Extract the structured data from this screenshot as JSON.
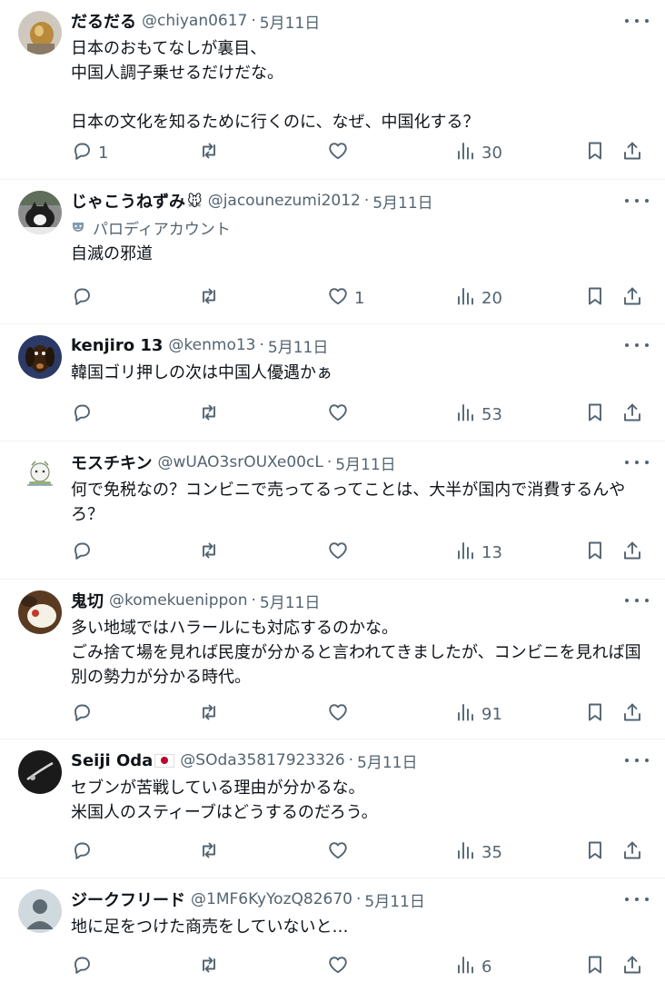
{
  "tweets": [
    {
      "name": "だるだる",
      "name_emoji": "",
      "has_flag": false,
      "handle": "@chiyan0617",
      "date": "5月11日",
      "parody_label": "",
      "text": "日本のおもてなしが裏目、\n中国人調子乗せるだけだな。\n\n日本の文化を知るために行くのに、なぜ、中国化する？",
      "replies": "1",
      "retweets": "",
      "likes": "",
      "views": "30",
      "avatar": "gold-lamp"
    },
    {
      "name": "じゃこうねずみ",
      "name_emoji": "🐭",
      "has_flag": false,
      "handle": "@jacounezumi2012",
      "date": "5月11日",
      "parody_label": "パロディアカウント",
      "text": "自滅の邪道",
      "replies": "",
      "retweets": "",
      "likes": "1",
      "views": "20",
      "avatar": "cat"
    },
    {
      "name": "kenjiro 13",
      "name_emoji": "",
      "has_flag": false,
      "handle": "@kenmo13",
      "date": "5月11日",
      "parody_label": "",
      "text": "韓国ゴリ押しの次は中国人優遇かぁ",
      "replies": "",
      "retweets": "",
      "likes": "",
      "views": "53",
      "avatar": "dog"
    },
    {
      "name": "モスチキン",
      "name_emoji": "",
      "has_flag": false,
      "handle": "@wUAO3srOUXe00cL",
      "date": "5月11日",
      "parody_label": "",
      "text": "何で免税なの？コンビニで売ってるってことは、大半が国内で消費するんやろ？",
      "replies": "",
      "retweets": "",
      "likes": "",
      "views": "13",
      "avatar": "character"
    },
    {
      "name": "鬼切",
      "name_emoji": "",
      "has_flag": false,
      "handle": "@komekuenippon",
      "date": "5月11日",
      "parody_label": "",
      "text": "多い地域ではハラールにも対応するのかな。\nごみ捨て場を見れば民度が分かると言われてきましたが、コンビニを見れば国別の勢力が分かる時代。",
      "replies": "",
      "retweets": "",
      "likes": "",
      "views": "91",
      "avatar": "rice"
    },
    {
      "name": "Seiji Oda",
      "name_emoji": "",
      "has_flag": true,
      "handle": "@SOda35817923326",
      "date": "5月11日",
      "parody_label": "",
      "text": "セブンが苦戦している理由が分かるな。\n米国人のスティーブはどうするのだろう。",
      "replies": "",
      "retweets": "",
      "likes": "",
      "views": "35",
      "avatar": "dark"
    },
    {
      "name": "ジークフリード",
      "name_emoji": "",
      "has_flag": false,
      "handle": "@1MF6KyYozQ82670",
      "date": "5月11日",
      "parody_label": "",
      "text": "地に足をつけた商売をしていないと…",
      "replies": "",
      "retweets": "",
      "likes": "",
      "views": "6",
      "avatar": "default"
    }
  ],
  "icons": {
    "reply": "speech-bubble-icon",
    "retweet": "retweet-icon",
    "like": "heart-icon",
    "views": "bar-chart-icon",
    "bookmark": "bookmark-icon",
    "share": "share-icon",
    "more": "more-dots-icon",
    "parody": "mask-icon"
  }
}
